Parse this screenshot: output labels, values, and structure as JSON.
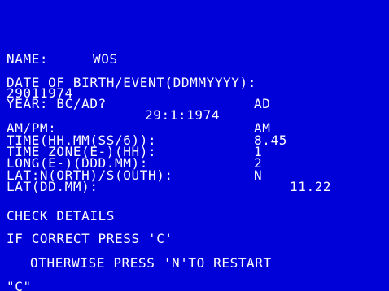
{
  "screen": {
    "background": "#0000d8",
    "text_color": "#ffffff"
  },
  "form": {
    "name_label": "NAME:",
    "name_value": "WOS",
    "dob_label": "DATE OF BIRTH/EVENT(DDMMYYYY):",
    "dob_value": "29011974",
    "era_label": "YEAR: BC/AD?",
    "era_value": "AD",
    "date_display": "29:1:1974",
    "ampm_label": "AM/PM:",
    "ampm_value": "AM",
    "time_label": "TIME(HH.MM(SS/6)):",
    "time_value": "8.45",
    "zone_label": "TIME ZONE(E-)(HH):",
    "zone_value": "1",
    "long_label": "LONG(E-)(DDD.MM):",
    "long_value": "2",
    "latdir_label": "LAT:N(ORTH)/S(OUTH):",
    "latdir_value": "N",
    "lat_label": "LAT(DD.MM):",
    "lat_value": "11.22"
  },
  "prompts": {
    "check": "CHECK DETAILS",
    "correct": "IF CORRECT PRESS 'C'",
    "otherwise": "OTHERWISE PRESS 'N'TO RESTART",
    "input": "\"C\""
  }
}
